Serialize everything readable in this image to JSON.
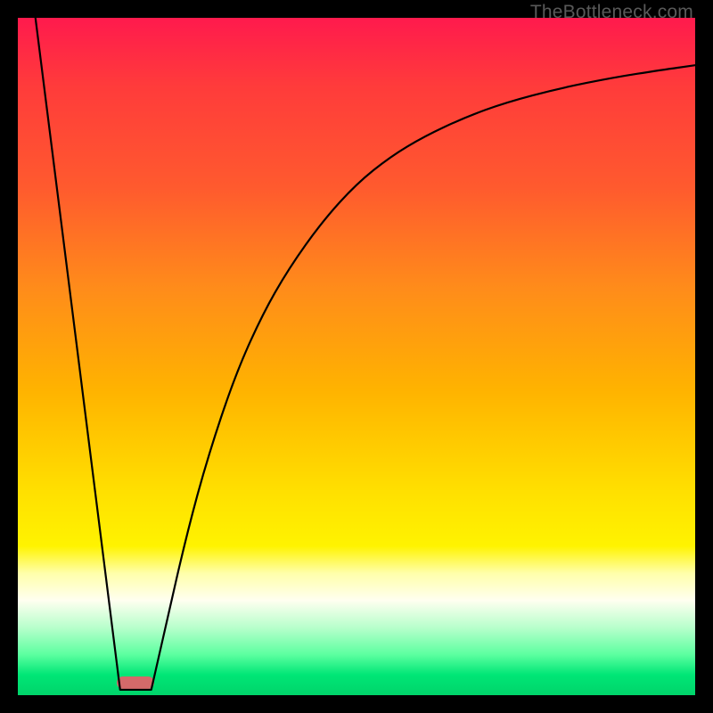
{
  "watermark": "TheBottleneck.com",
  "chart_data": {
    "type": "line",
    "title": "",
    "xlabel": "",
    "ylabel": "",
    "xlim": [
      0,
      100
    ],
    "ylim": [
      0,
      100
    ],
    "series": [
      {
        "name": "left-line",
        "x": [
          2.6,
          15.1
        ],
        "y": [
          100,
          0.8
        ]
      },
      {
        "name": "right-curve",
        "x": [
          19.7,
          22,
          25,
          28,
          32,
          36,
          40,
          45,
          50,
          55,
          60,
          66,
          72,
          80,
          88,
          95,
          100
        ],
        "y": [
          0.8,
          11,
          24,
          35,
          47,
          56,
          63,
          70,
          75.5,
          79.5,
          82.5,
          85.3,
          87.5,
          89.6,
          91.2,
          92.3,
          93
        ]
      }
    ],
    "marker": {
      "x_center_pct": 17.4,
      "y_from_bottom_pct": 0.9,
      "width_pct": 5.5,
      "height_pct": 1.8
    },
    "gradient_stops": [
      {
        "pct": 0,
        "color": "#ff1a4d"
      },
      {
        "pct": 25,
        "color": "#ff5a2e"
      },
      {
        "pct": 55,
        "color": "#ffb300"
      },
      {
        "pct": 78,
        "color": "#fff300"
      },
      {
        "pct": 90,
        "color": "#b8ffcc"
      },
      {
        "pct": 100,
        "color": "#00d46a"
      }
    ]
  }
}
